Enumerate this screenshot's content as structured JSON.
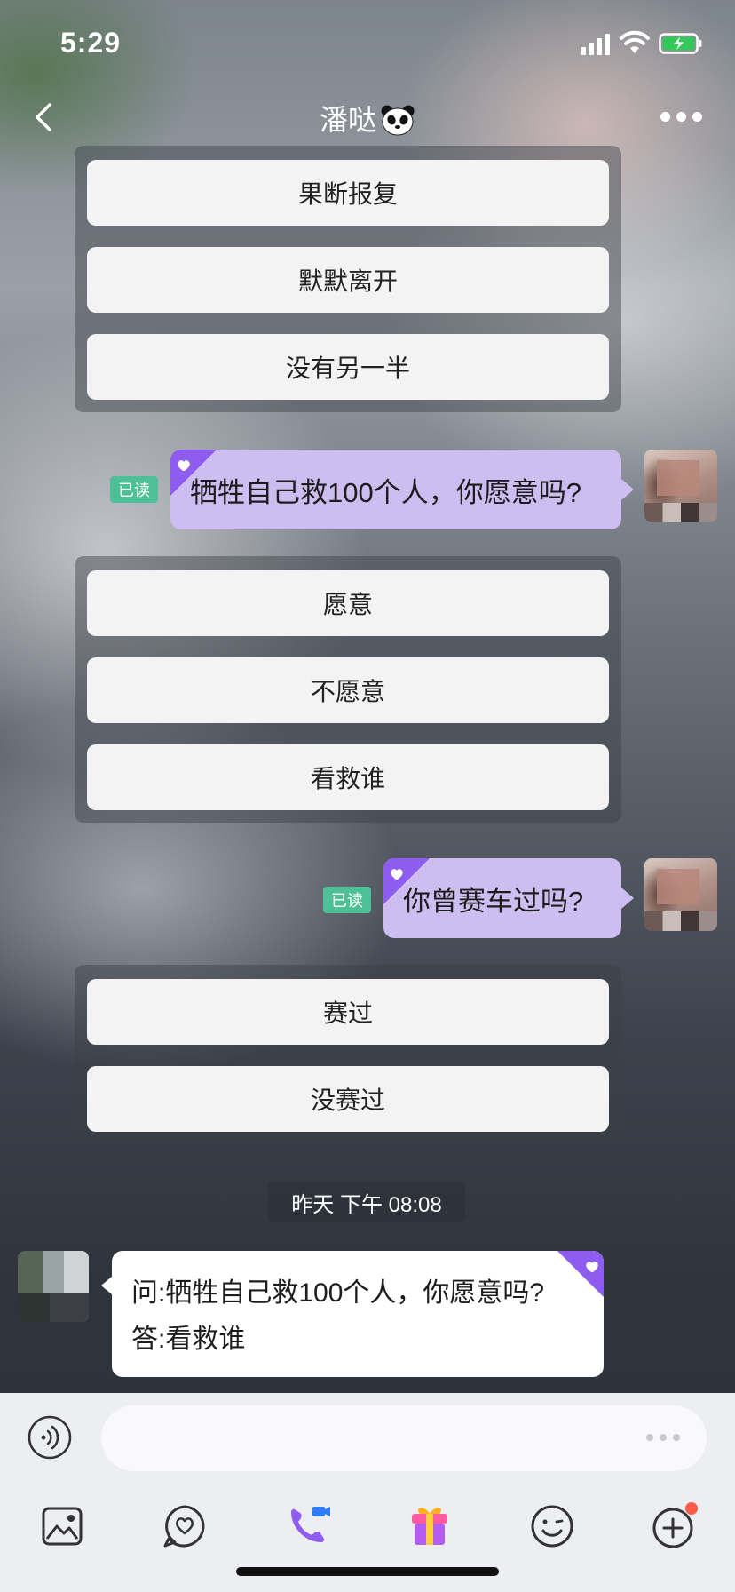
{
  "status_bar": {
    "time": "5:29"
  },
  "header": {
    "title": "潘哒"
  },
  "option_groups": [
    {
      "options": [
        "果断报复",
        "默默离开",
        "没有另一半"
      ]
    },
    {
      "options": [
        "愿意",
        "不愿意",
        "看救谁"
      ]
    },
    {
      "options": [
        "赛过",
        "没赛过"
      ]
    }
  ],
  "sent_messages": [
    {
      "text": "牺牲自己救100个人，你愿意吗?",
      "read_label": "已读"
    },
    {
      "text": "你曾赛车过吗?",
      "read_label": "已读"
    }
  ],
  "timestamp": "昨天 下午 08:08",
  "received_message": {
    "line1": "问:牺牲自己救100个人，你愿意吗?",
    "line2": "答:看救谁"
  },
  "input": {
    "placeholder": ""
  },
  "toolbar": {
    "icons": [
      "image-icon",
      "heart-chat-icon",
      "video-call-icon",
      "gift-icon",
      "emoji-icon",
      "plus-icon"
    ]
  },
  "colors": {
    "accent_purple": "#8f5cf0",
    "sent_bubble": "#cdbdf0",
    "read_tag": "#4fc096",
    "notification_dot": "#ff5b4a"
  }
}
